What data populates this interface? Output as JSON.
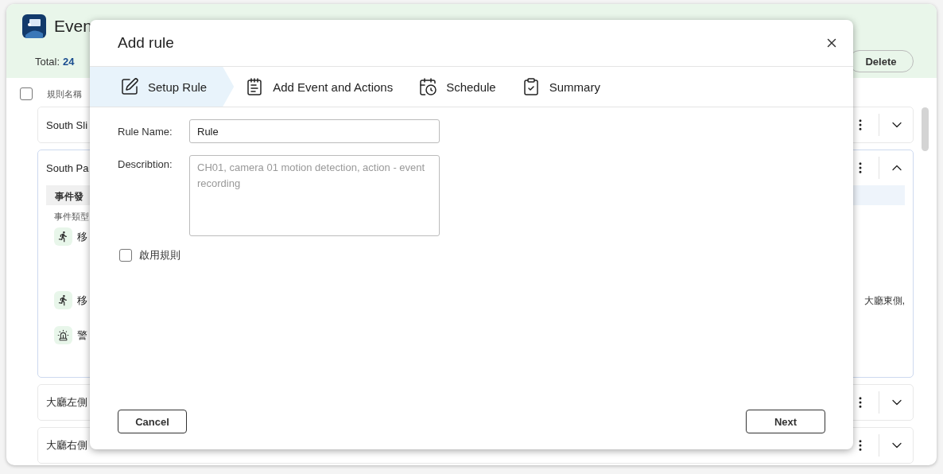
{
  "app": {
    "title": "Even",
    "total_label": "Total:",
    "total_value": "24",
    "delete_button": "Delete"
  },
  "list": {
    "header_checkbox": {
      "checked": false
    },
    "header_label": "規則名稱",
    "rows": [
      {
        "name": "South Sli",
        "expanded": false
      },
      {
        "name": "South Pa",
        "expanded": true,
        "section_title": "事件發",
        "type_label": "事件類型",
        "events": [
          {
            "kind": "motion",
            "label": "移"
          },
          {
            "kind": "motion",
            "label": "移",
            "detail": "大廳東側,"
          },
          {
            "kind": "alarm",
            "label": "警"
          }
        ]
      },
      {
        "name": "大廳左側",
        "expanded": false
      },
      {
        "name": "大廳右側",
        "expanded": false
      }
    ]
  },
  "dialog": {
    "title": "Add rule",
    "steps": [
      {
        "kind": "edit",
        "label": "Setup Rule",
        "selected": true
      },
      {
        "kind": "list",
        "label": "Add Event and Actions",
        "selected": false
      },
      {
        "kind": "calendar",
        "label": "Schedule",
        "selected": false
      },
      {
        "kind": "summary",
        "label": "Summary",
        "selected": false
      }
    ],
    "rule_name": {
      "label": "Rule Name:",
      "value": "Rule"
    },
    "description": {
      "label": "Describtion:",
      "placeholder": "CH01, camera 01 motion detection, action - event recording"
    },
    "enable": {
      "label": "啟用規則",
      "checked": false
    },
    "cancel_button": "Cancel",
    "next_button": "Next"
  }
}
